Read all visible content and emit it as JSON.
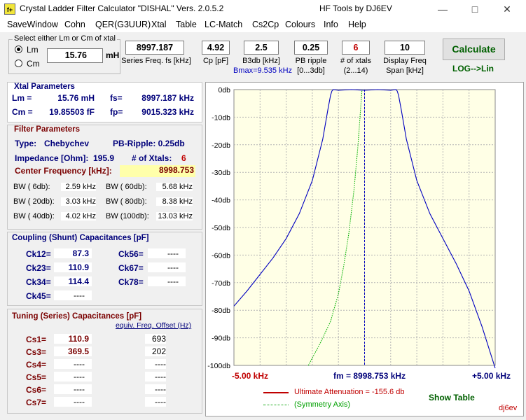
{
  "window": {
    "title": "Crystal Ladder Filter Calculator  \"DISHAL\"  Vers. 2.0.5.2",
    "right_title": "HF Tools by DJ6EV",
    "logo": "f+"
  },
  "menu": [
    "SaveWindow",
    "Cohn",
    "QER(G3UUR)",
    "Xtal",
    "Table",
    "LC-Match",
    "Cs2Cp",
    "Colours",
    "Info",
    "Help"
  ],
  "select": {
    "legend": "Select either Lm or Cm of xtal",
    "lm_label": "Lm",
    "cm_label": "Cm",
    "value": "15.76",
    "unit": "mH",
    "selected": "Lm"
  },
  "inputs": [
    {
      "value": "8997.187",
      "label": "Series Freq. fs [kHz]"
    },
    {
      "value": "4.92",
      "label": "Cp [pF]"
    },
    {
      "value": "2.5",
      "label": "B3db [kHz]",
      "sub": "Bmax=9.535 kHz"
    },
    {
      "value": "0.25",
      "label": "PB ripple",
      "sub": "[0...3db]"
    },
    {
      "value": "6",
      "label": "# of xtals",
      "sub": "(2...14)"
    },
    {
      "value": "10",
      "label": "Display Freq",
      "sub": "Span [kHz]"
    }
  ],
  "calculate_label": "Calculate",
  "log_lin_label": "LOG-->Lin",
  "xtal": {
    "title": "Xtal Parameters",
    "lm_label": "Lm =",
    "lm_value": "15.76 mH",
    "fs_label": "fs=",
    "fs_value": "8997.187 kHz",
    "cm_label": "Cm =",
    "cm_value": "19.85503  fF",
    "fp_label": "fp=",
    "fp_value": "9015.323 kHz"
  },
  "filter": {
    "title": "Filter Parameters",
    "type_label": "Type:",
    "type_value": "Chebychev",
    "ripple_text": "PB-Ripple: 0.25db",
    "imp_label": "Impedance [Ohm]:",
    "imp_value": "195.9",
    "nx_label": "# of Xtals:",
    "nx_value": "6",
    "cf_label": "Center Frequency [kHz]:",
    "cf_value": "8998.753",
    "bw": [
      {
        "l": "BW (  6db):",
        "v": "2.59 kHz",
        "l2": "BW ( 60db):",
        "v2": "5.68 kHz"
      },
      {
        "l": "BW ( 20db):",
        "v": "3.03 kHz",
        "l2": "BW ( 80db):",
        "v2": "8.38 kHz"
      },
      {
        "l": "BW ( 40db):",
        "v": "4.02 kHz",
        "l2": "BW (100db):",
        "v2": "13.03 kHz"
      }
    ]
  },
  "coupling": {
    "title": "Coupling (Shunt) Capacitances [pF]",
    "left": [
      {
        "l": "Ck12=",
        "v": "87.3"
      },
      {
        "l": "Ck23=",
        "v": "110.9"
      },
      {
        "l": "Ck34=",
        "v": "114.4"
      },
      {
        "l": "Ck45=",
        "v": "----"
      }
    ],
    "right": [
      {
        "l": "Ck56=",
        "v": "----"
      },
      {
        "l": "Ck67=",
        "v": "----"
      },
      {
        "l": "Ck78=",
        "v": "----"
      }
    ]
  },
  "tuning": {
    "title": "Tuning (Series) Capacitances [pF]",
    "link": "equiv. Freq. Offset (Hz)",
    "rows": [
      {
        "l": "Cs1=",
        "v": "110.9",
        "o": "693"
      },
      {
        "l": "Cs3=",
        "v": "369.5",
        "o": "202"
      },
      {
        "l": "Cs4=",
        "v": "----",
        "o": "----"
      },
      {
        "l": "Cs5=",
        "v": "----",
        "o": "----"
      },
      {
        "l": "Cs6=",
        "v": "----",
        "o": "----"
      },
      {
        "l": "Cs7=",
        "v": "----",
        "o": "----"
      }
    ]
  },
  "chart_data": {
    "type": "line",
    "x_unit": "kHz offset from fm",
    "xlim": [
      -5,
      5
    ],
    "ylim": [
      -100,
      0
    ],
    "yticks": [
      "0db",
      "-10db",
      "-20db",
      "-30db",
      "-40db",
      "-50db",
      "-60db",
      "-70db",
      "-80db",
      "-90db",
      "-100db"
    ],
    "x_left_label": "-5.00 kHz",
    "x_center_label": "fm = 8998.753 kHz",
    "x_right_label": "+5.00 kHz",
    "grid": true,
    "background": "#ffffe6",
    "series": [
      {
        "color": "#0000c0",
        "x": [
          -5.0,
          -4.5,
          -4.0,
          -3.5,
          -3.0,
          -2.5,
          -2.0,
          -1.6,
          -1.4,
          -1.3,
          -1.25,
          -1.2,
          -1.0,
          -0.5,
          0.0,
          0.5,
          1.0,
          1.2,
          1.25,
          1.3,
          1.4,
          1.6,
          2.0,
          2.5,
          3.0,
          3.5,
          4.0,
          4.5,
          5.0
        ],
        "y": [
          -78.5,
          -73,
          -67,
          -61,
          -54,
          -45,
          -33,
          -18,
          -7,
          -2,
          -0.5,
          0,
          -0.25,
          0,
          -0.25,
          0,
          -0.25,
          0,
          -0.5,
          -2,
          -7,
          -18,
          -33,
          -45,
          -54,
          -63,
          -73,
          -86,
          -101
        ]
      },
      {
        "color": "#00b000",
        "dotted": true,
        "x": [
          -2.15,
          -1.7,
          -1.3,
          -1.0,
          -0.8,
          -0.6,
          -0.4,
          -0.25,
          -0.1
        ],
        "y": [
          -100,
          -92,
          -84,
          -74,
          -64,
          -52,
          -36,
          -20,
          0
        ]
      }
    ],
    "center_marker": 0
  },
  "legend": {
    "att_label": "Ultimate Attenuation =  -155.6 db",
    "sym_label": "(Symmetry Axis)",
    "show_table": "Show Table",
    "signature": "dj6ev",
    "att_color": "#c00000",
    "sym_color": "#00a000"
  }
}
